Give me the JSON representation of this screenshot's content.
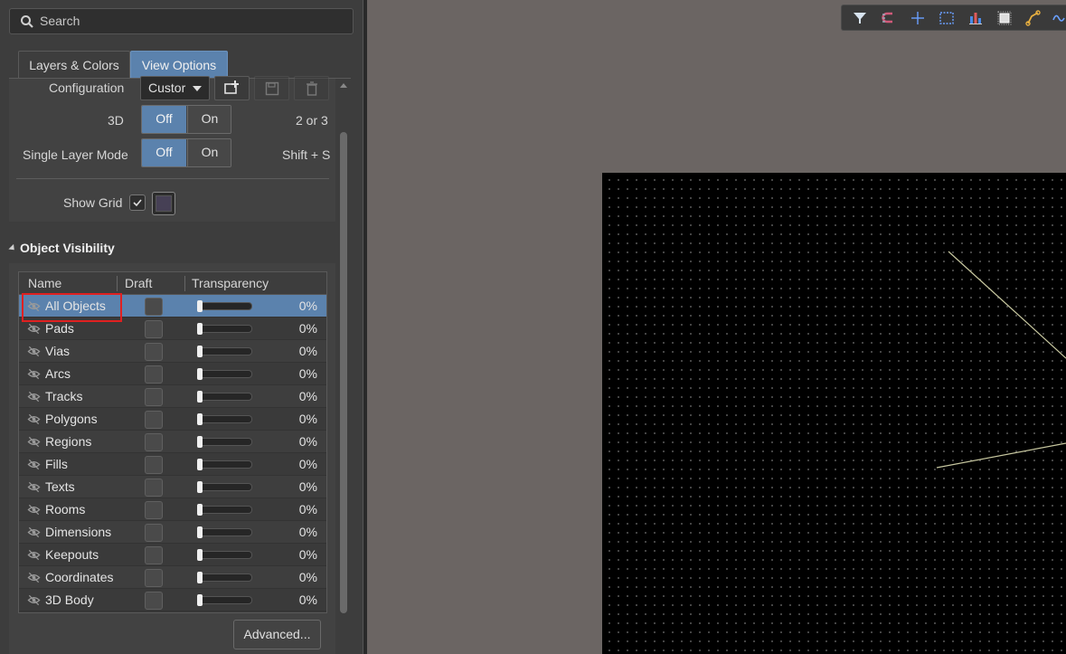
{
  "search": {
    "placeholder": "Search"
  },
  "tabs": [
    {
      "label": "Layers & Colors",
      "active": false
    },
    {
      "label": "View Options",
      "active": true
    }
  ],
  "config": {
    "configuration_label": "Configuration",
    "configuration_value": "Custor",
    "three_d": {
      "label": "3D",
      "off": "Off",
      "on": "On",
      "selected": "Off",
      "shortcut": "2 or 3"
    },
    "single_layer": {
      "label": "Single Layer Mode",
      "off": "Off",
      "on": "On",
      "selected": "Off",
      "shortcut": "Shift + S"
    },
    "show_grid": {
      "label": "Show Grid",
      "checked": true
    }
  },
  "object_visibility": {
    "title": "Object Visibility",
    "columns": [
      "Name",
      "Draft",
      "Transparency"
    ],
    "rows": [
      {
        "name": "All Objects",
        "transparency": "0%",
        "selected": true
      },
      {
        "name": "Pads",
        "transparency": "0%"
      },
      {
        "name": "Vias",
        "transparency": "0%"
      },
      {
        "name": "Arcs",
        "transparency": "0%"
      },
      {
        "name": "Tracks",
        "transparency": "0%"
      },
      {
        "name": "Polygons",
        "transparency": "0%"
      },
      {
        "name": "Regions",
        "transparency": "0%"
      },
      {
        "name": "Fills",
        "transparency": "0%"
      },
      {
        "name": "Texts",
        "transparency": "0%"
      },
      {
        "name": "Rooms",
        "transparency": "0%"
      },
      {
        "name": "Dimensions",
        "transparency": "0%"
      },
      {
        "name": "Keepouts",
        "transparency": "0%"
      },
      {
        "name": "Coordinates",
        "transparency": "0%"
      },
      {
        "name": "3D Body",
        "transparency": "0%"
      }
    ],
    "advanced_label": "Advanced..."
  },
  "colors": {
    "accent": "#5b82ad",
    "highlight": "#e02020",
    "board": "#000000",
    "canvas_bg": "#6b6563"
  },
  "toolbar_icons": [
    "filter-icon",
    "interactive-routing-icon",
    "crosshair-icon",
    "select-box-icon",
    "chart-icon",
    "component-icon",
    "route-icon",
    "wave-icon"
  ]
}
